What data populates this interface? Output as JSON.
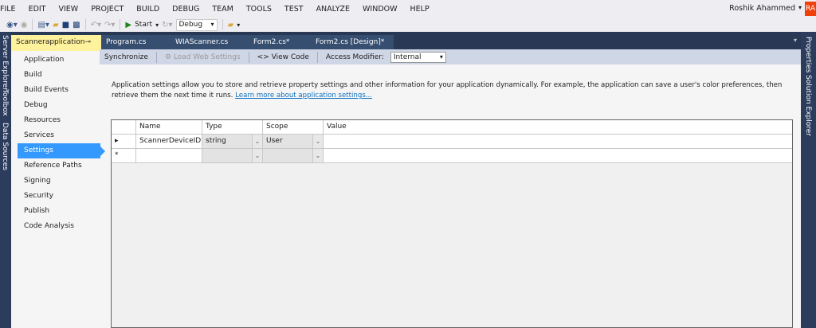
{
  "menu": [
    "FILE",
    "EDIT",
    "VIEW",
    "PROJECT",
    "BUILD",
    "DEBUG",
    "TEAM",
    "TOOLS",
    "TEST",
    "ANALYZE",
    "WINDOW",
    "HELP"
  ],
  "user": {
    "name": "Roshik Ahammed",
    "initials": "RA"
  },
  "toolbar": {
    "start": "Start",
    "config": "Debug"
  },
  "left_strip": [
    "Server Explorer",
    "Toolbox",
    "Data Sources"
  ],
  "right_strip": [
    "Properties",
    "Solution Explorer"
  ],
  "tabs": [
    "Scannerapplication",
    "Program.cs",
    "WIAScanner.cs",
    "Form2.cs*",
    "Form2.cs [Design]*"
  ],
  "doc_toolbar": {
    "synchronize": "Synchronize",
    "load_web": "Load Web Settings",
    "view_code": "View Code",
    "access_label": "Access Modifier:",
    "access_value": "Internal"
  },
  "sidebar": [
    "Application",
    "Build",
    "Build Events",
    "Debug",
    "Resources",
    "Services",
    "Settings",
    "Reference Paths",
    "Signing",
    "Security",
    "Publish",
    "Code Analysis"
  ],
  "description": "Application settings allow you to store and retrieve property settings and other information for your application dynamically. For example, the application can save a user's color preferences, then retrieve them the next time it runs.",
  "learn_more": "Learn more about application settings...",
  "grid": {
    "headers": [
      "Name",
      "Type",
      "Scope",
      "Value"
    ],
    "rows": [
      {
        "marker": "▸",
        "name": "ScannerDeviceID",
        "type": "string",
        "scope": "User",
        "value": ""
      },
      {
        "marker": "*",
        "name": "",
        "type": "",
        "scope": "",
        "value": ""
      }
    ]
  }
}
